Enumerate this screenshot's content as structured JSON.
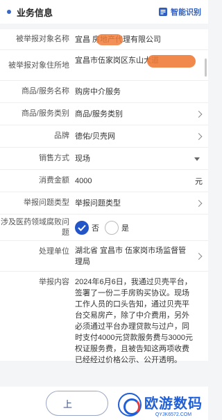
{
  "header": {
    "title": "业务信息",
    "smart_label": "智能识别"
  },
  "fields": {
    "target_name": {
      "label": "被举报对象名称",
      "value": "宜昌      房地产代理有限公司"
    },
    "target_addr": {
      "label": "被举报对象住所地",
      "value": "宜昌市伍家岗区东山大道"
    },
    "goods_name": {
      "label": "商品/服务名称",
      "value": "购房中介服务"
    },
    "goods_type": {
      "label": "商品/服务类别",
      "value": "商品/服务类别"
    },
    "brand": {
      "label": "品牌",
      "value": "德佑/贝壳网"
    },
    "sales": {
      "label": "销售方式",
      "value": "现场"
    },
    "amount": {
      "label": "消费金额",
      "value": "4000",
      "unit": "元"
    },
    "issue_type": {
      "label": "举报问题类型",
      "value": "举报问题类型"
    },
    "corruption": {
      "label": "涉及医药领域腐败问题",
      "yes": "是",
      "no": "否",
      "selected": "no"
    },
    "unit": {
      "label": "处理单位",
      "value": "湖北省 宜昌市 伍家岗市场监督管理局"
    },
    "content": {
      "label": "举报内容",
      "value": "2024年6月6日，我通过贝壳平台，签署了一份二手房购买协议。现场工作人员的口头告知，通过贝壳平台交易房产，除了中介费用，另外必须通过平台办理贷款与过户，同时支付4000元贷款服务费与3000元权证服务费，且被告知这两项收费已经经过价格公示、公开透明。"
    }
  },
  "footer": {
    "prev_label": "上",
    "watermark_main": "欧游数码",
    "watermark_sub": "QYJK6572.COM"
  },
  "colors": {
    "accent": "#2355c7",
    "redaction": "#f07c3a"
  }
}
